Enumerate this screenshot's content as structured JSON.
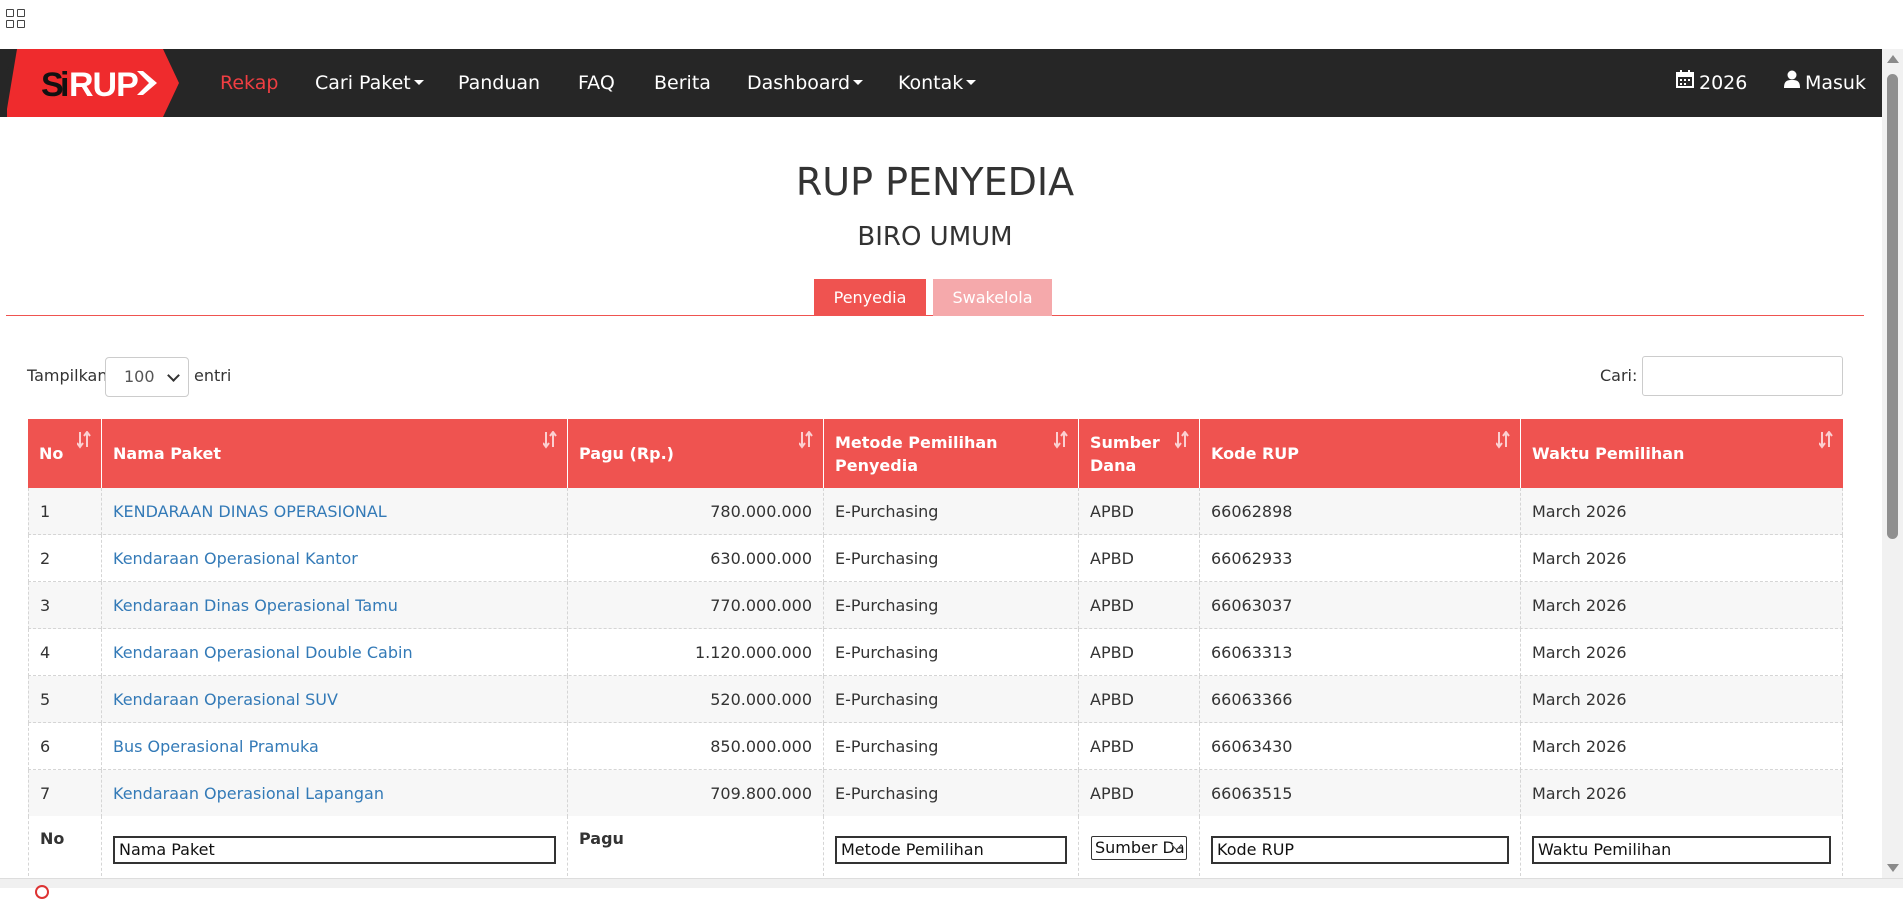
{
  "nav": {
    "logo_text": "SiRUP",
    "items": [
      {
        "label": "Rekap",
        "active": true,
        "dropdown": false
      },
      {
        "label": "Cari Paket",
        "active": false,
        "dropdown": true
      },
      {
        "label": "Panduan",
        "active": false,
        "dropdown": false
      },
      {
        "label": "FAQ",
        "active": false,
        "dropdown": false
      },
      {
        "label": "Berita",
        "active": false,
        "dropdown": false
      },
      {
        "label": "Dashboard",
        "active": false,
        "dropdown": true
      },
      {
        "label": "Kontak",
        "active": false,
        "dropdown": true
      }
    ],
    "year": "2026",
    "login": "Masuk"
  },
  "page": {
    "title": "RUP PENYEDIA",
    "subtitle": "BIRO UMUM"
  },
  "tabs": [
    {
      "label": "Penyedia",
      "active": true
    },
    {
      "label": "Swakelola",
      "active": false
    }
  ],
  "controls": {
    "show_label": "Tampilkan",
    "page_length": "100",
    "entries_label": "entri",
    "search_label": "Cari:",
    "search_value": ""
  },
  "table": {
    "headers": [
      "No",
      "Nama Paket",
      "Pagu (Rp.)",
      "Metode Pemilihan Penyedia",
      "Sumber Dana",
      "Kode RUP",
      "Waktu Pemilihan"
    ],
    "rows": [
      [
        "1",
        "KENDARAAN DINAS OPERASIONAL",
        "780.000.000",
        "E-Purchasing",
        "APBD",
        "66062898",
        "March 2026"
      ],
      [
        "2",
        "Kendaraan Operasional Kantor",
        "630.000.000",
        "E-Purchasing",
        "APBD",
        "66062933",
        "March 2026"
      ],
      [
        "3",
        "Kendaraan Dinas Operasional Tamu",
        "770.000.000",
        "E-Purchasing",
        "APBD",
        "66063037",
        "March 2026"
      ],
      [
        "4",
        "Kendaraan Operasional Double Cabin",
        "1.120.000.000",
        "E-Purchasing",
        "APBD",
        "66063313",
        "March 2026"
      ],
      [
        "5",
        "Kendaraan Operasional SUV",
        "520.000.000",
        "E-Purchasing",
        "APBD",
        "66063366",
        "March 2026"
      ],
      [
        "6",
        "Bus Operasional Pramuka",
        "850.000.000",
        "E-Purchasing",
        "APBD",
        "66063430",
        "March 2026"
      ],
      [
        "7",
        "Kendaraan Operasional Lapangan",
        "709.800.000",
        "E-Purchasing",
        "APBD",
        "66063515",
        "March 2026"
      ]
    ],
    "footer": {
      "no": "No",
      "nama_paket": "Nama Paket",
      "pagu": "Pagu",
      "metode": "Metode Pemilihan",
      "sumber": "Sumber Dana",
      "kode": "Kode RUP",
      "waktu": "Waktu Pemilihan"
    }
  },
  "colors": {
    "navbar": "#262626",
    "accent": "#ef5350",
    "active_nav": "#ef3e42",
    "link": "#337ab7"
  }
}
